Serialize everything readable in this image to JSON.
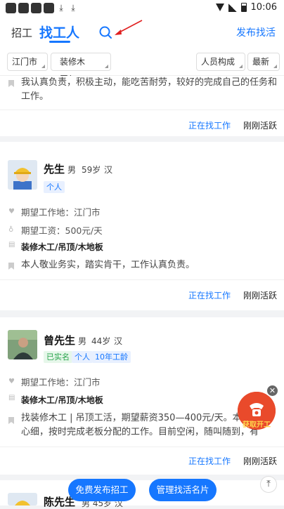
{
  "status_bar": {
    "time": "10:06"
  },
  "header": {
    "tab_recruit": "招工",
    "tab_find_workers": "找工人",
    "publish_link": "发布找活"
  },
  "filters": {
    "city": "江门市",
    "category": "装修木工/...",
    "people": "人员构成",
    "sort": "最新"
  },
  "top_card": {
    "description": "我认真负责，积极主动，能吃苦耐劳，较好的完成自己的任务和工作。",
    "status": "正在找工作",
    "active": "刚刚活跃"
  },
  "workers": [
    {
      "name": "先生",
      "gender": "男",
      "age": "59岁",
      "ethnicity": "汉",
      "tags": [
        "个人"
      ],
      "expected_location": "期望工作地：江门市",
      "expected_salary": "期望工资：500元/天",
      "skill": "装修木工/吊顶/木地板",
      "description": "本人敬业务实，踏实肯干，工作认真负责。",
      "status": "正在找工作",
      "active": "刚刚活跃"
    },
    {
      "name": "曾先生",
      "gender": "男",
      "age": "44岁",
      "ethnicity": "汉",
      "tags": [
        "已实名",
        "个人",
        "10年工龄"
      ],
      "expected_location": "期望工作地：江门市",
      "skill": "装修木工/吊顶/木地板",
      "description_line1": "找装修木工 | 吊顶工活，期望薪资350—400元/天。本",
      "description_line2": "心细，按时完成老板分配的工作。目前空闲，随叫随到，有",
      "status": "正在找工作",
      "active": "刚刚活跃"
    },
    {
      "name": "陈先生",
      "partial_meta": "男  45岁  汉"
    }
  ],
  "floating_badge": {
    "text": "获取开工"
  },
  "bottom": {
    "post_job": "免费发布招工",
    "manage_card": "管理找活名片"
  },
  "colors": {
    "accent": "#1677ff",
    "green": "#27a34a",
    "badge_red": "#e94a2b"
  }
}
